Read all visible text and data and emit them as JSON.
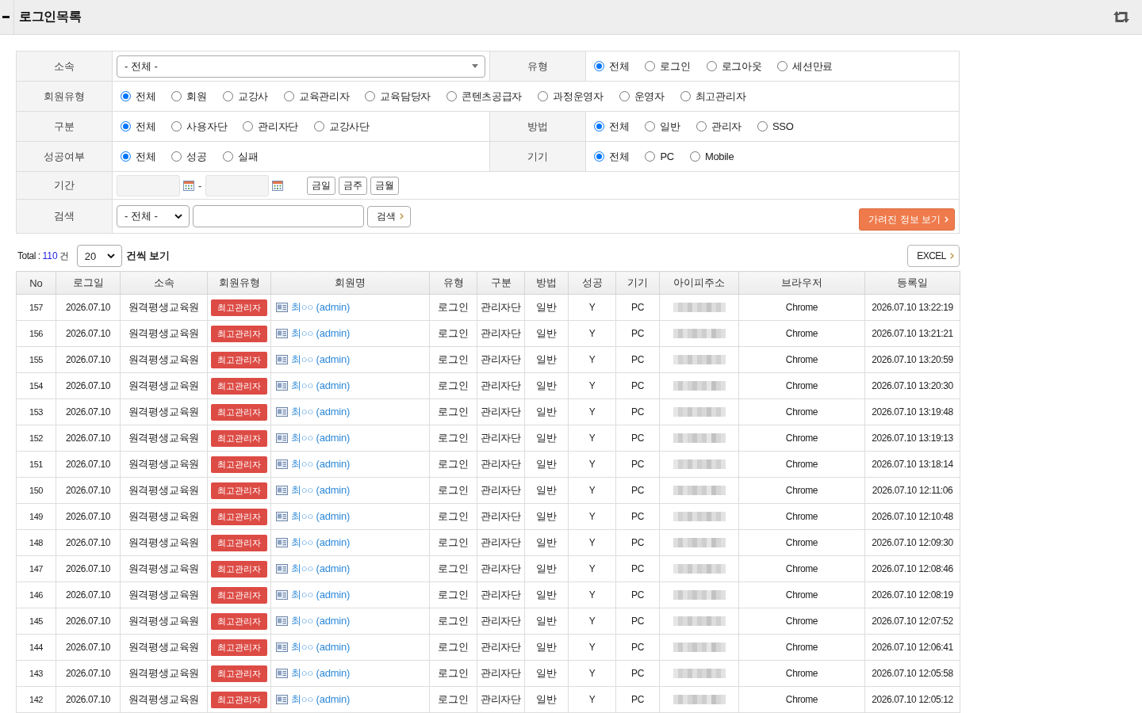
{
  "panel": {
    "title": "로그인목록"
  },
  "filters": {
    "affiliation": {
      "label": "소속",
      "value": "- 전체 -"
    },
    "log_type": {
      "label": "유형",
      "options": [
        {
          "label": "전체",
          "selected": true
        },
        {
          "label": "로그인",
          "selected": false
        },
        {
          "label": "로그아웃",
          "selected": false
        },
        {
          "label": "세션만료",
          "selected": false
        }
      ]
    },
    "member_type": {
      "label": "회원유형",
      "options": [
        {
          "label": "전체",
          "selected": true
        },
        {
          "label": "회원",
          "selected": false
        },
        {
          "label": "교강사",
          "selected": false
        },
        {
          "label": "교육관리자",
          "selected": false
        },
        {
          "label": "교육담당자",
          "selected": false
        },
        {
          "label": "콘텐츠공급자",
          "selected": false
        },
        {
          "label": "과정운영자",
          "selected": false
        },
        {
          "label": "운영자",
          "selected": false
        },
        {
          "label": "최고관리자",
          "selected": false
        }
      ]
    },
    "section": {
      "label": "구분",
      "options": [
        {
          "label": "전체",
          "selected": true
        },
        {
          "label": "사용자단",
          "selected": false
        },
        {
          "label": "관리자단",
          "selected": false
        },
        {
          "label": "교강사단",
          "selected": false
        }
      ]
    },
    "method": {
      "label": "방법",
      "options": [
        {
          "label": "전체",
          "selected": true
        },
        {
          "label": "일반",
          "selected": false
        },
        {
          "label": "관리자",
          "selected": false
        },
        {
          "label": "SSO",
          "selected": false
        }
      ]
    },
    "success": {
      "label": "성공여부",
      "options": [
        {
          "label": "전체",
          "selected": true
        },
        {
          "label": "성공",
          "selected": false
        },
        {
          "label": "실패",
          "selected": false
        }
      ]
    },
    "device": {
      "label": "기기",
      "options": [
        {
          "label": "전체",
          "selected": true
        },
        {
          "label": "PC",
          "selected": false
        },
        {
          "label": "Mobile",
          "selected": false
        }
      ]
    },
    "period": {
      "label": "기간",
      "separator": "-",
      "buttons": [
        "금일",
        "금주",
        "금월"
      ]
    },
    "search": {
      "label": "검색",
      "scope": "- 전체 -",
      "button": "검색"
    },
    "reveal_button": "가려진 정보 보기"
  },
  "summary": {
    "total_label": "Total :",
    "total_count": "110",
    "total_unit": "건",
    "page_size": "20",
    "page_size_suffix": "건씩 보기",
    "excel_button": "EXCEL"
  },
  "table": {
    "columns": [
      "No",
      "로그일",
      "소속",
      "회원유형",
      "회원명",
      "유형",
      "구분",
      "방법",
      "성공",
      "기기",
      "아이피주소",
      "브라우저",
      "등록일"
    ],
    "rows": [
      {
        "no": "157",
        "log_date": "2026.07.10",
        "affiliation": "원격평생교육원",
        "member_type": "최고관리자",
        "member_name": "최○○ (admin)",
        "type": "로그인",
        "section": "관리자단",
        "method": "일반",
        "success": "Y",
        "device": "PC",
        "browser": "Chrome",
        "registered_at": "2026.07.10 13:22:19"
      },
      {
        "no": "156",
        "log_date": "2026.07.10",
        "affiliation": "원격평생교육원",
        "member_type": "최고관리자",
        "member_name": "최○○ (admin)",
        "type": "로그인",
        "section": "관리자단",
        "method": "일반",
        "success": "Y",
        "device": "PC",
        "browser": "Chrome",
        "registered_at": "2026.07.10 13:21:21"
      },
      {
        "no": "155",
        "log_date": "2026.07.10",
        "affiliation": "원격평생교육원",
        "member_type": "최고관리자",
        "member_name": "최○○ (admin)",
        "type": "로그인",
        "section": "관리자단",
        "method": "일반",
        "success": "Y",
        "device": "PC",
        "browser": "Chrome",
        "registered_at": "2026.07.10 13:20:59"
      },
      {
        "no": "154",
        "log_date": "2026.07.10",
        "affiliation": "원격평생교육원",
        "member_type": "최고관리자",
        "member_name": "최○○ (admin)",
        "type": "로그인",
        "section": "관리자단",
        "method": "일반",
        "success": "Y",
        "device": "PC",
        "browser": "Chrome",
        "registered_at": "2026.07.10 13:20:30"
      },
      {
        "no": "153",
        "log_date": "2026.07.10",
        "affiliation": "원격평생교육원",
        "member_type": "최고관리자",
        "member_name": "최○○ (admin)",
        "type": "로그인",
        "section": "관리자단",
        "method": "일반",
        "success": "Y",
        "device": "PC",
        "browser": "Chrome",
        "registered_at": "2026.07.10 13:19:48"
      },
      {
        "no": "152",
        "log_date": "2026.07.10",
        "affiliation": "원격평생교육원",
        "member_type": "최고관리자",
        "member_name": "최○○ (admin)",
        "type": "로그인",
        "section": "관리자단",
        "method": "일반",
        "success": "Y",
        "device": "PC",
        "browser": "Chrome",
        "registered_at": "2026.07.10 13:19:13"
      },
      {
        "no": "151",
        "log_date": "2026.07.10",
        "affiliation": "원격평생교육원",
        "member_type": "최고관리자",
        "member_name": "최○○ (admin)",
        "type": "로그인",
        "section": "관리자단",
        "method": "일반",
        "success": "Y",
        "device": "PC",
        "browser": "Chrome",
        "registered_at": "2026.07.10 13:18:14"
      },
      {
        "no": "150",
        "log_date": "2026.07.10",
        "affiliation": "원격평생교육원",
        "member_type": "최고관리자",
        "member_name": "최○○ (admin)",
        "type": "로그인",
        "section": "관리자단",
        "method": "일반",
        "success": "Y",
        "device": "PC",
        "browser": "Chrome",
        "registered_at": "2026.07.10 12:11:06"
      },
      {
        "no": "149",
        "log_date": "2026.07.10",
        "affiliation": "원격평생교육원",
        "member_type": "최고관리자",
        "member_name": "최○○ (admin)",
        "type": "로그인",
        "section": "관리자단",
        "method": "일반",
        "success": "Y",
        "device": "PC",
        "browser": "Chrome",
        "registered_at": "2026.07.10 12:10:48"
      },
      {
        "no": "148",
        "log_date": "2026.07.10",
        "affiliation": "원격평생교육원",
        "member_type": "최고관리자",
        "member_name": "최○○ (admin)",
        "type": "로그인",
        "section": "관리자단",
        "method": "일반",
        "success": "Y",
        "device": "PC",
        "browser": "Chrome",
        "registered_at": "2026.07.10 12:09:30"
      },
      {
        "no": "147",
        "log_date": "2026.07.10",
        "affiliation": "원격평생교육원",
        "member_type": "최고관리자",
        "member_name": "최○○ (admin)",
        "type": "로그인",
        "section": "관리자단",
        "method": "일반",
        "success": "Y",
        "device": "PC",
        "browser": "Chrome",
        "registered_at": "2026.07.10 12:08:46"
      },
      {
        "no": "146",
        "log_date": "2026.07.10",
        "affiliation": "원격평생교육원",
        "member_type": "최고관리자",
        "member_name": "최○○ (admin)",
        "type": "로그인",
        "section": "관리자단",
        "method": "일반",
        "success": "Y",
        "device": "PC",
        "browser": "Chrome",
        "registered_at": "2026.07.10 12:08:19"
      },
      {
        "no": "145",
        "log_date": "2026.07.10",
        "affiliation": "원격평생교육원",
        "member_type": "최고관리자",
        "member_name": "최○○ (admin)",
        "type": "로그인",
        "section": "관리자단",
        "method": "일반",
        "success": "Y",
        "device": "PC",
        "browser": "Chrome",
        "registered_at": "2026.07.10 12:07:52"
      },
      {
        "no": "144",
        "log_date": "2026.07.10",
        "affiliation": "원격평생교육원",
        "member_type": "최고관리자",
        "member_name": "최○○ (admin)",
        "type": "로그인",
        "section": "관리자단",
        "method": "일반",
        "success": "Y",
        "device": "PC",
        "browser": "Chrome",
        "registered_at": "2026.07.10 12:06:41"
      },
      {
        "no": "143",
        "log_date": "2026.07.10",
        "affiliation": "원격평생교육원",
        "member_type": "최고관리자",
        "member_name": "최○○ (admin)",
        "type": "로그인",
        "section": "관리자단",
        "method": "일반",
        "success": "Y",
        "device": "PC",
        "browser": "Chrome",
        "registered_at": "2026.07.10 12:05:58"
      },
      {
        "no": "142",
        "log_date": "2026.07.10",
        "affiliation": "원격평생교육원",
        "member_type": "최고관리자",
        "member_name": "최○○ (admin)",
        "type": "로그인",
        "section": "관리자단",
        "method": "일반",
        "success": "Y",
        "device": "PC",
        "browser": "Chrome",
        "registered_at": "2026.07.10 12:05:12"
      }
    ]
  }
}
